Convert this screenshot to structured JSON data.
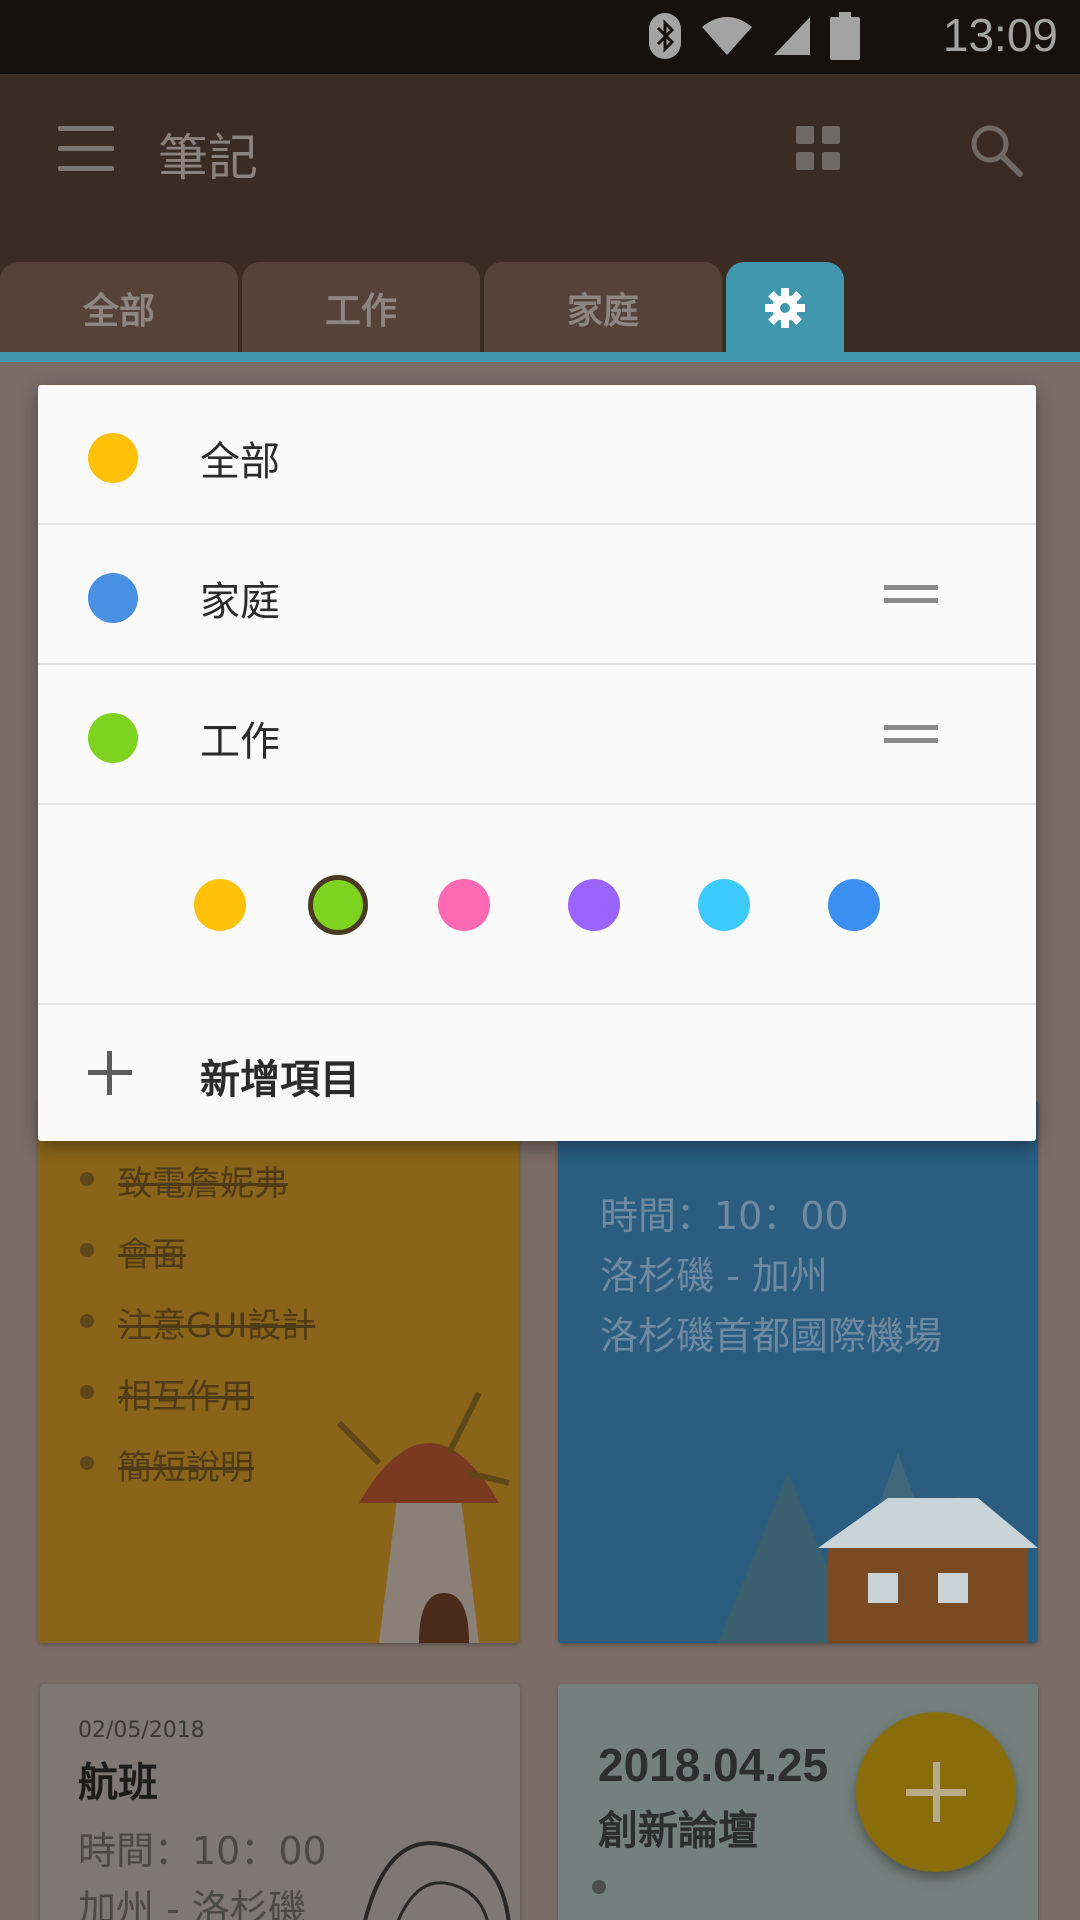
{
  "status": {
    "time": "13:09"
  },
  "appbar": {
    "title": "筆記"
  },
  "tabs": [
    {
      "label": "全部"
    },
    {
      "label": "工作"
    },
    {
      "label": "家庭"
    }
  ],
  "popup": {
    "items": [
      {
        "label": "全部",
        "color": "#ffc107"
      },
      {
        "label": "家庭",
        "color": "#4a90e2"
      },
      {
        "label": "工作",
        "color": "#7ed321"
      }
    ],
    "palette": [
      "#ffc107",
      "#7ed321",
      "#ff69b4",
      "#9b63ff",
      "#3ccaff",
      "#3b8ff0"
    ],
    "selected_palette_index": 1,
    "add_label": "新增項目"
  },
  "cards": {
    "todo_items": [
      "致電詹妮弗",
      "會面",
      "注意GUI設計",
      "相互作用",
      "簡短說明"
    ],
    "blue": {
      "line1": "時間：10：00",
      "line2": "洛杉磯 - 加州",
      "line3": "洛杉磯首都國際機場"
    },
    "grey": {
      "date": "02/05/2018",
      "title": "航班",
      "line1": "時間：10：00",
      "line2": "加州 - 洛杉磯"
    },
    "teal": {
      "date": "2018.04.25",
      "title": "創新論壇"
    }
  }
}
